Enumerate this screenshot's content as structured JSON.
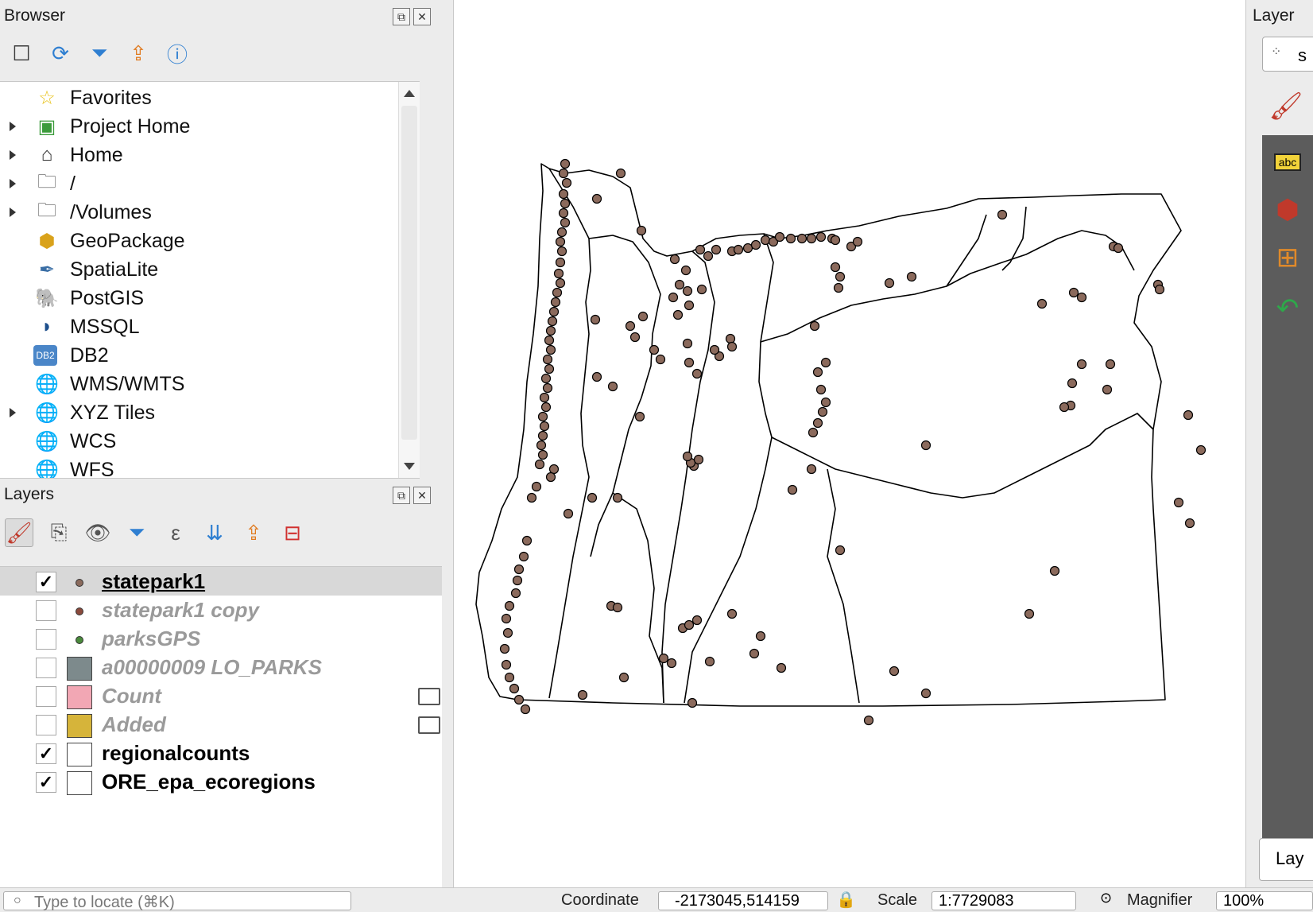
{
  "browser": {
    "title": "Browser",
    "items": [
      {
        "label": "Favorites",
        "icon": "star-icon",
        "glyph": "☆",
        "color": "#e8c21a",
        "expandable": false
      },
      {
        "label": "Project Home",
        "icon": "project-home-icon",
        "glyph": "▣",
        "color": "#3b9b3b",
        "expandable": true
      },
      {
        "label": "Home",
        "icon": "home-icon",
        "glyph": "⌂",
        "color": "#333333",
        "expandable": true
      },
      {
        "label": "/",
        "icon": "folder-icon",
        "glyph": "🗀",
        "color": "#555555",
        "expandable": true
      },
      {
        "label": "/Volumes",
        "icon": "folder-icon",
        "glyph": "🗀",
        "color": "#555555",
        "expandable": true
      },
      {
        "label": "GeoPackage",
        "icon": "geopackage-icon",
        "glyph": "⬢",
        "color": "#d9a21b",
        "expandable": false
      },
      {
        "label": "SpatiaLite",
        "icon": "feather-icon",
        "glyph": "✒",
        "color": "#3a6ea5",
        "expandable": false
      },
      {
        "label": "PostGIS",
        "icon": "elephant-icon",
        "glyph": "🐘",
        "color": "#336791",
        "expandable": false
      },
      {
        "label": "MSSQL",
        "icon": "mssql-icon",
        "glyph": "◗",
        "color": "#1e4f8c",
        "expandable": false
      },
      {
        "label": "DB2",
        "icon": "db2-icon",
        "glyph": "DB2",
        "color": "#4a86c8",
        "expandable": false
      },
      {
        "label": "WMS/WMTS",
        "icon": "globe-icon",
        "glyph": "🌐",
        "color": "#3a6ea5",
        "expandable": false
      },
      {
        "label": "XYZ Tiles",
        "icon": "globe-icon",
        "glyph": "🌐",
        "color": "#3a6ea5",
        "expandable": true
      },
      {
        "label": "WCS",
        "icon": "globe-icon",
        "glyph": "🌐",
        "color": "#2a4f7a",
        "expandable": false
      },
      {
        "label": "WFS",
        "icon": "globe-icon",
        "glyph": "🌐",
        "color": "#3a6ea5",
        "expandable": false
      }
    ]
  },
  "layers": {
    "title": "Layers",
    "items": [
      {
        "name": "statepark1",
        "checked": true,
        "symbol": "dot",
        "color": "#8a6a5c",
        "active": true,
        "raster": false
      },
      {
        "name": "statepark1 copy",
        "checked": false,
        "symbol": "dot",
        "color": "#8a4a3c",
        "active": false,
        "raster": false
      },
      {
        "name": "parksGPS",
        "checked": false,
        "symbol": "dot",
        "color": "#4a8a3c",
        "active": false,
        "raster": false
      },
      {
        "name": "a00000009 LO_PARKS",
        "checked": false,
        "symbol": "box",
        "color": "#7d8a8c",
        "active": false,
        "raster": false
      },
      {
        "name": "Count",
        "checked": false,
        "symbol": "box",
        "color": "#f2a7b4",
        "active": false,
        "raster": true
      },
      {
        "name": "Added",
        "checked": false,
        "symbol": "box",
        "color": "#d6b43a",
        "active": false,
        "raster": true
      },
      {
        "name": "regionalcounts",
        "checked": true,
        "symbol": "box",
        "color": "#ffffff",
        "active": false,
        "raster": false
      },
      {
        "name": "ORE_epa_ecoregions",
        "checked": true,
        "symbol": "box",
        "color": "#ffffff",
        "active": false,
        "raster": false
      }
    ]
  },
  "right_dock": {
    "title": "Layer",
    "partial_button": "s",
    "bottom_label": "Lay"
  },
  "statusbar": {
    "search_placeholder": "Type to locate (⌘K)",
    "coordinate_label": "Coordinate",
    "coordinate_value": "-2173045,514159",
    "scale_label": "Scale",
    "scale_value": "1:7729083",
    "magnifier_label": "Magnifier",
    "magnifier_value": "100%"
  },
  "map_colors": {
    "point_fill": "#8b6a5c",
    "outline": "#000000"
  }
}
